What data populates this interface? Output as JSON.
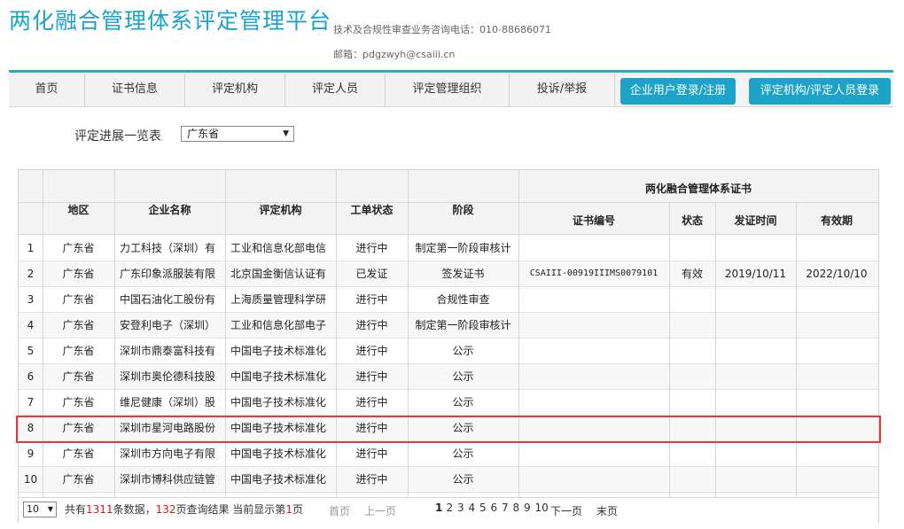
{
  "header": {
    "title": "两化融合管理体系评定管理平台",
    "phone": "技术及合规性审查业务咨询电话：010-88686071",
    "email": "邮箱：pdgzwyh@csaiii.cn"
  },
  "nav": {
    "items": [
      "首页",
      "证书信息",
      "评定机构",
      "评定人员",
      "评定管理组织",
      "投诉/举报"
    ],
    "buttons": [
      "企业用户登录/注册",
      "评定机构/评定人员登录"
    ]
  },
  "filter": {
    "label": "评定进展一览表",
    "selected": "广东省"
  },
  "table": {
    "headers": {
      "region": "地区",
      "company": "企业名称",
      "agency": "评定机构",
      "status": "工单状态",
      "stage": "阶段",
      "cert_group": "两化融合管理体系证书",
      "cert_no": "证书编号",
      "cert_status": "状态",
      "issue_date": "发证时间",
      "valid_until": "有效期"
    },
    "rows": [
      {
        "no": "1",
        "region": "广东省",
        "company": "力工科技（深圳）有",
        "agency": "工业和信息化部电信",
        "status": "进行中",
        "stage": "制定第一阶段审核计",
        "cert_no": "",
        "cert_status": "",
        "issue_date": "",
        "valid_until": ""
      },
      {
        "no": "2",
        "region": "广东省",
        "company": "广东印象派服装有限",
        "agency": "北京国金衡信认证有",
        "status": "已发证",
        "stage": "签发证书",
        "cert_no": "CSAIII-00919IIIMS0079101",
        "cert_status": "有效",
        "issue_date": "2019/10/11",
        "valid_until": "2022/10/10"
      },
      {
        "no": "3",
        "region": "广东省",
        "company": "中国石油化工股份有",
        "agency": "上海质量管理科学研",
        "status": "进行中",
        "stage": "合规性审查",
        "cert_no": "",
        "cert_status": "",
        "issue_date": "",
        "valid_until": ""
      },
      {
        "no": "4",
        "region": "广东省",
        "company": "安登利电子（深圳）",
        "agency": "工业和信息化部电子",
        "status": "进行中",
        "stage": "制定第一阶段审核计",
        "cert_no": "",
        "cert_status": "",
        "issue_date": "",
        "valid_until": ""
      },
      {
        "no": "5",
        "region": "广东省",
        "company": "深圳市鼎泰富科技有",
        "agency": "中国电子技术标准化",
        "status": "进行中",
        "stage": "公示",
        "cert_no": "",
        "cert_status": "",
        "issue_date": "",
        "valid_until": ""
      },
      {
        "no": "6",
        "region": "广东省",
        "company": "深圳市奥伦德科技股",
        "agency": "中国电子技术标准化",
        "status": "进行中",
        "stage": "公示",
        "cert_no": "",
        "cert_status": "",
        "issue_date": "",
        "valid_until": ""
      },
      {
        "no": "7",
        "region": "广东省",
        "company": "维尼健康（深圳）股",
        "agency": "中国电子技术标准化",
        "status": "进行中",
        "stage": "公示",
        "cert_no": "",
        "cert_status": "",
        "issue_date": "",
        "valid_until": ""
      },
      {
        "no": "8",
        "region": "广东省",
        "company": "深圳市星河电路股份",
        "agency": "中国电子技术标准化",
        "status": "进行中",
        "stage": "公示",
        "cert_no": "",
        "cert_status": "",
        "issue_date": "",
        "valid_until": ""
      },
      {
        "no": "9",
        "region": "广东省",
        "company": "深圳市方向电子有限",
        "agency": "中国电子技术标准化",
        "status": "进行中",
        "stage": "公示",
        "cert_no": "",
        "cert_status": "",
        "issue_date": "",
        "valid_until": ""
      },
      {
        "no": "10",
        "region": "广东省",
        "company": "深圳市博科供应链管",
        "agency": "中国电子技术标准化",
        "status": "进行中",
        "stage": "公示",
        "cert_no": "",
        "cert_status": "",
        "issue_date": "",
        "valid_until": ""
      }
    ]
  },
  "pager": {
    "page_size": "10",
    "total_prefix": "共有",
    "total_records": "1311",
    "records_suffix": "条数据，",
    "total_pages": "132",
    "pages_suffix": "页查询结果 当前显示第",
    "current_page": "1",
    "current_suffix": "页",
    "first": "首页",
    "prev": "上一页",
    "pages": [
      "1",
      "2",
      "3",
      "4",
      "5",
      "6",
      "7",
      "8",
      "9",
      "10"
    ],
    "next": "下一页",
    "last": "末页"
  },
  "colors": {
    "brand": "#1aa3c8",
    "button": "#1da2c8",
    "highlight_box": "#e33b3b",
    "count_red": "#d9161b"
  }
}
